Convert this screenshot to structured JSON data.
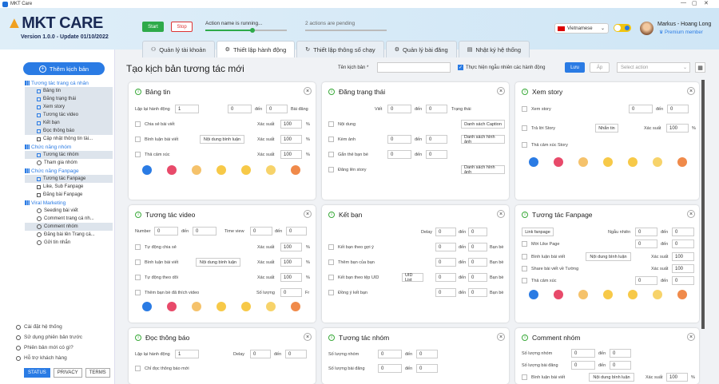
{
  "window": {
    "title": "MKT Care"
  },
  "brand": {
    "logo_main": "MKT CARE",
    "version": "Version 1.0.0 - Update 01/10/2022"
  },
  "controls": {
    "start": "Start",
    "stop": "Stop",
    "status_running": "Action name is running...",
    "status_pending": "2 actions are pending",
    "progress": 0.58
  },
  "lang": {
    "selected": "Vietnamese"
  },
  "user": {
    "name": "Markus - Hoang Long",
    "plan": "Premium member"
  },
  "tabs": [
    {
      "label": "Quản lý tài khoản",
      "icon": "users-icon"
    },
    {
      "label": "Thiết lập hành động",
      "icon": "gear-icon"
    },
    {
      "label": "Thiết lập thông số chạy",
      "icon": "refresh-icon"
    },
    {
      "label": "Quản lý bài đăng",
      "icon": "settings-icon"
    },
    {
      "label": "Nhật ký hệ thống",
      "icon": "log-icon"
    }
  ],
  "sidebar": {
    "add_button": "Thêm kịch bản",
    "sections": [
      {
        "title": "Tương tác trang cá nhân",
        "items": [
          "Bảng tin",
          "Đăng trạng thái",
          "Xem story",
          "Tương tác video",
          "Kết bạn",
          "Đọc thông báo",
          "Cập nhật thông tin tài..."
        ]
      },
      {
        "title": "Chức năng nhóm",
        "items": [
          "Tương tác nhóm",
          "Tham gia nhóm"
        ]
      },
      {
        "title": "Chức năng Fanpage",
        "items": [
          "Tương tác Fanpage",
          "Like, Sub Fanpage",
          "Đăng bài Fanpage"
        ]
      },
      {
        "title": "Viral Marketing",
        "items": [
          "Seeding bài viết",
          "Comment trang cá nh...",
          "Comment nhóm",
          "Đăng bài lên Trang cá...",
          "Gửi tin nhắn"
        ]
      }
    ],
    "footer": [
      "Cài đặt hệ thống",
      "Sử dụng phiên bản trước",
      "Phiên bản mới có gì?",
      "Hỗ trợ khách hàng"
    ],
    "footer_tabs": [
      "STATUS",
      "PRIVACY",
      "TERMS"
    ]
  },
  "main": {
    "title": "Tạo kịch bản tương tác mới",
    "script_label": "Tên kịch bản *",
    "random_label": "Thực hiện ngẫu nhiên các hành động",
    "save": "Lưu",
    "apply": "Áp",
    "select_placeholder": "Select action"
  },
  "cards": {
    "bangtin": {
      "title": "Bảng tin",
      "f1": "Lặp lại hành động",
      "v1": "1",
      "v2": "0",
      "den": "đến",
      "v3": "0",
      "unit1": "Bài đăng",
      "c1": "Chia sẻ bài viết",
      "xs": "Xác suất",
      "p1": "100",
      "pct": "%",
      "c2": "Bình luận bài viết",
      "b1": "Nội dung bình luận",
      "p2": "100",
      "c3": "Thả cảm xúc",
      "p3": "100"
    },
    "dangtrangthai": {
      "title": "Đăng trạng thái",
      "viet": "Viết",
      "v1": "0",
      "den": "đến",
      "v2": "0",
      "unit": "Trạng thái",
      "c1": "Nội dung",
      "b1": "Danh sách Caption",
      "c2": "Kèm ảnh",
      "v3": "0",
      "v4": "0",
      "b2": "Danh sách hình ảnh",
      "c3": "Gắn thẻ bạn bè",
      "v5": "0",
      "v6": "0",
      "c4": "Đăng lên story",
      "b3": "Danh sách hình ảnh"
    },
    "xemstory": {
      "title": "Xem story",
      "c1": "Xem story",
      "v1": "0",
      "den": "đến",
      "v2": "0",
      "c2": "Trả lời Story",
      "b1": "Nhắn tin",
      "xs": "Xác suất",
      "p1": "100",
      "pct": "%",
      "c3": "Thả cảm xúc Story"
    },
    "tuongtacvideo": {
      "title": "Tương tác video",
      "num": "Number",
      "v1": "0",
      "den": "đến",
      "v2": "0",
      "tv": "Time view",
      "v3": "0",
      "v4": "0",
      "c1": "Tự động chia sẻ",
      "xs": "Xác suất",
      "p1": "100",
      "pct": "%",
      "c2": "Bình luận bài viết",
      "b1": "Nội dung bình luận",
      "p2": "100",
      "c3": "Tự động theo dõi",
      "p3": "100",
      "c4": "Thêm bạn bè đã thích video",
      "sl": "Số lượng",
      "p4": "0",
      "unit": "Fr"
    },
    "ketban": {
      "title": "Kết bạn",
      "delay": "Delay",
      "v1": "0",
      "den": "đến",
      "v2": "0",
      "c1": "Kết bạn theo gợi ý",
      "v3": "0",
      "v4": "0",
      "u": "Bạn bè",
      "c2": "Thêm bạn của bạn",
      "v5": "0",
      "v6": "0",
      "c3": "Kết bạn theo tệp UID",
      "b1": "UID List",
      "v7": "0",
      "v8": "0",
      "c4": "Đồng ý kết bạn",
      "v9": "0",
      "v10": "0"
    },
    "tuongtacfanpage": {
      "title": "Tương tác Fanpage",
      "b1": "Link fanpage",
      "nn": "Ngẫu nhiên",
      "v1": "0",
      "den": "đến",
      "v2": "0",
      "c1": "Mời Like Page",
      "v3": "0",
      "v4": "0",
      "c2": "Bình luận bài viết",
      "b2": "Nội dung bình luận",
      "xs": "Xác suất",
      "p1": "100",
      "c3": "Share bài viết về Tường",
      "p2": "100",
      "c4": "Thả cảm xúc",
      "v5": "0",
      "v6": "0"
    },
    "docthongbao": {
      "title": "Đọc thông báo",
      "f1": "Lặp lại hành động",
      "v1": "1",
      "delay": "Delay",
      "v2": "0",
      "den": "đến",
      "v3": "0",
      "c1": "Chỉ đọc thông báo mới"
    },
    "tuongtacnhom": {
      "title": "Tương tác nhóm",
      "f1": "Số lượng nhóm",
      "v1": "0",
      "den": "đến",
      "v2": "0",
      "f2": "Số lượng bài đăng",
      "v3": "0",
      "v4": "0"
    },
    "commentnhom": {
      "title": "Comment nhóm",
      "f1": "Số lượng nhóm",
      "v1": "0",
      "den": "đến",
      "v2": "0",
      "f2": "Số lượng bài đăng",
      "v3": "0",
      "v4": "0",
      "c1": "Bình luận bài viết",
      "b1": "Nội dung bình luận",
      "xs": "Xác suất",
      "p1": "100",
      "pct": "%"
    }
  }
}
